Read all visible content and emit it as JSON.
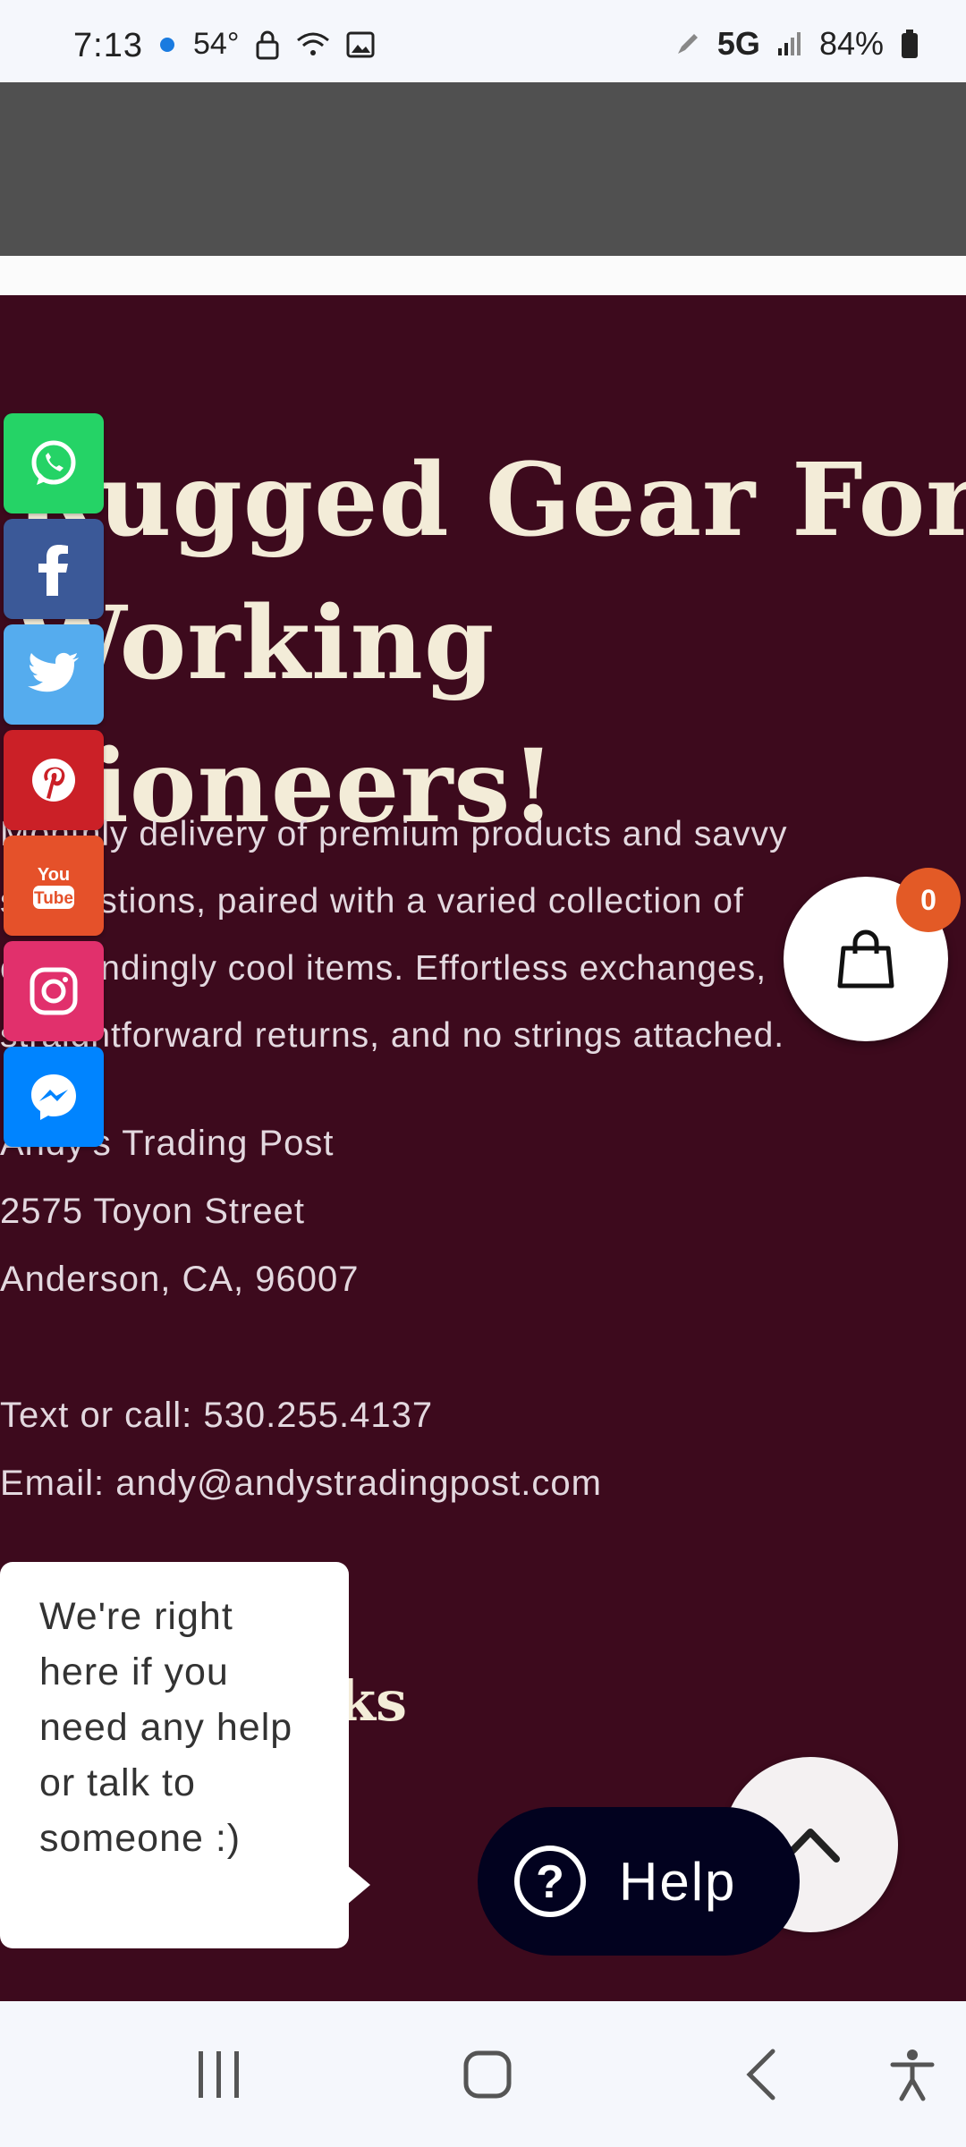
{
  "status_bar": {
    "time": "7:13",
    "temp": "54°",
    "network": "5G",
    "battery": "84%"
  },
  "hero": {
    "title_line1": "Rugged Gear For",
    "title_line2": "Working Pioneers!",
    "description": "Monthly delivery of premium products and savvy suggestions, paired with a varied collection of outstandingly cool items. Effortless exchanges, straightforward returns, and no strings attached."
  },
  "contact": {
    "business_name": "Andy's Trading Post",
    "street": "2575 Toyon Street",
    "city": "Anderson, CA, 96007",
    "phone": "Text or call: 530.255.4137",
    "email": "Email: andy@andystradingpost.com"
  },
  "links_section": {
    "title": "Quick Links"
  },
  "social": [
    {
      "name": "whatsapp",
      "color": "#25d366"
    },
    {
      "name": "facebook",
      "color": "#3b5998"
    },
    {
      "name": "twitter",
      "color": "#55acee"
    },
    {
      "name": "pinterest",
      "color": "#cb2027"
    },
    {
      "name": "youtube",
      "color": "#e52d27"
    },
    {
      "name": "instagram",
      "color": "#e1306c"
    },
    {
      "name": "messenger",
      "color": "#0084ff"
    }
  ],
  "cart": {
    "count": "0",
    "icon": "shopping-bag-icon"
  },
  "chat_bubble": {
    "text": "We're right here if you need any help or talk to someone :)"
  },
  "help_button": {
    "label": "Help"
  }
}
